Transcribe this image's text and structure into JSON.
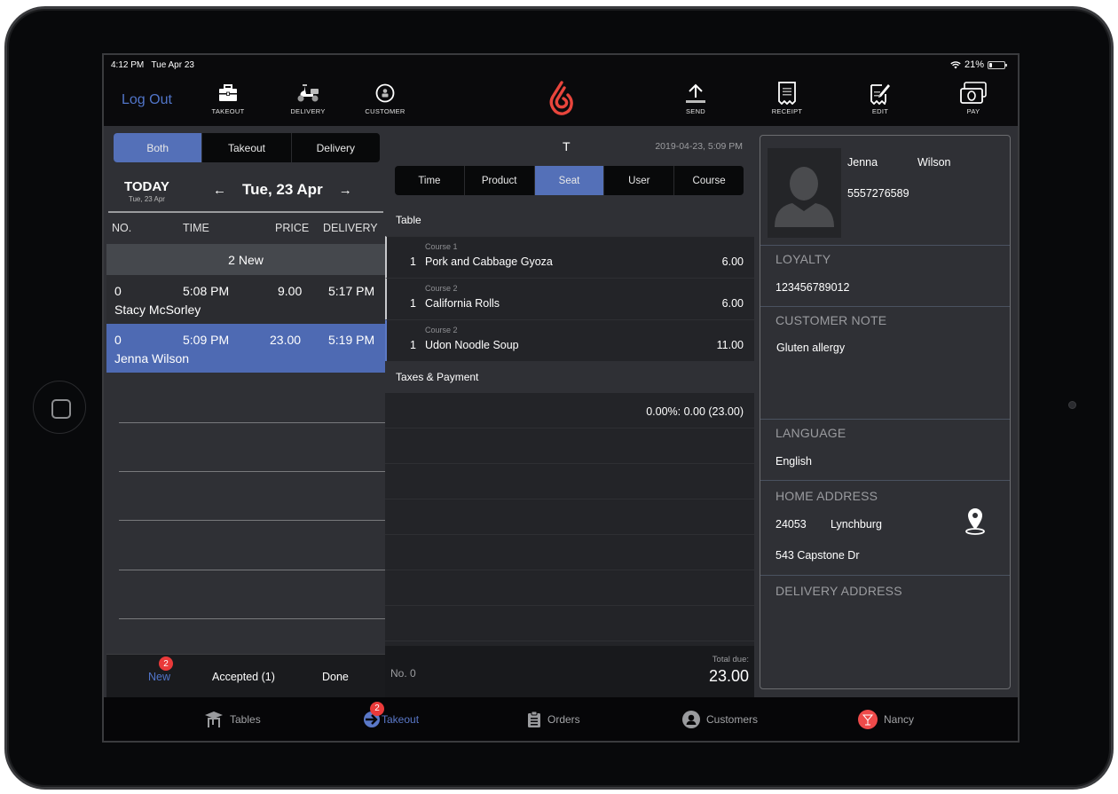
{
  "status_bar": {
    "time": "4:12 PM",
    "date": "Tue Apr 23",
    "battery": "21%",
    "battery_level": 0.21,
    "wifi_icon": "wifi-icon"
  },
  "toolbar": {
    "logout_label": "Log Out",
    "left_tools": [
      {
        "label": "TAKEOUT",
        "icon": "briefcase-icon"
      },
      {
        "label": "DELIVERY",
        "icon": "scooter-icon"
      },
      {
        "label": "CUSTOMER",
        "icon": "customer-circle-icon"
      }
    ],
    "right_tools": [
      {
        "label": "SEND",
        "icon": "upload-icon"
      },
      {
        "label": "RECEIPT",
        "icon": "receipt-icon"
      },
      {
        "label": "EDIT",
        "icon": "edit-receipt-icon"
      },
      {
        "label": "PAY",
        "icon": "cash-icon"
      }
    ],
    "logo_color": "#e8453c"
  },
  "left_panel": {
    "filter_tabs": [
      "Both",
      "Takeout",
      "Delivery"
    ],
    "active_filter": "Both",
    "today_label": "TODAY",
    "today_sub": "Tue, 23 Apr",
    "current_date": "Tue, 23 Apr",
    "prev_arrow": "←",
    "next_arrow": "→",
    "columns": [
      "NO.",
      "TIME",
      "PRICE",
      "DELIVERY"
    ],
    "group_header": "2 New",
    "orders": [
      {
        "no": "0",
        "time": "5:08 PM",
        "price": "9.00",
        "delivery": "5:17 PM",
        "customer": "Stacy McSorley",
        "selected": false
      },
      {
        "no": "0",
        "time": "5:09 PM",
        "price": "23.00",
        "delivery": "5:19 PM",
        "customer": "Jenna Wilson",
        "selected": true
      }
    ],
    "status_tabs": [
      {
        "label": "New",
        "badge": "2",
        "active": true
      },
      {
        "label": "Accepted (1)",
        "active": false
      },
      {
        "label": "Done",
        "active": false
      }
    ]
  },
  "order_detail": {
    "title": "T",
    "datetime": "2019-04-23, 5:09 PM",
    "sort_tabs": [
      "Time",
      "Product",
      "Seat",
      "User",
      "Course"
    ],
    "active_sort": "Seat",
    "table_header": "Table",
    "items": [
      {
        "course": "Course 1",
        "qty": "1",
        "name": "Pork and Cabbage Gyoza",
        "price": "6.00"
      },
      {
        "course": "Course 2",
        "qty": "1",
        "name": "California Rolls",
        "price": "6.00"
      },
      {
        "course": "Course 2",
        "qty": "1",
        "name": "Udon Noodle Soup",
        "price": "11.00"
      }
    ],
    "taxes_header": "Taxes & Payment",
    "tax_line": "0.00%: 0.00 (23.00)",
    "order_no": "No. 0",
    "total_label": "Total due:",
    "total_value": "23.00"
  },
  "customer": {
    "first_name": "Jenna",
    "last_name": "Wilson",
    "phone": "5557276589",
    "loyalty_label": "LOYALTY",
    "loyalty_value": "123456789012",
    "note_label": "CUSTOMER NOTE",
    "note_value": "Gluten allergy",
    "language_label": "LANGUAGE",
    "language_value": "English",
    "home_address_label": "HOME ADDRESS",
    "zip": "24053",
    "city": "Lynchburg",
    "street": "543 Capstone Dr",
    "delivery_address_label": "DELIVERY ADDRESS"
  },
  "bottom_nav": [
    {
      "label": "Tables",
      "icon": "table-icon",
      "active": false
    },
    {
      "label": "Takeout",
      "icon": "takeout-arrow-icon",
      "active": true,
      "badge": "2"
    },
    {
      "label": "Orders",
      "icon": "clipboard-icon",
      "active": false
    },
    {
      "label": "Customers",
      "icon": "person-circle-icon",
      "active": false
    },
    {
      "label": "Nancy",
      "icon": "user-avatar-icon",
      "active": false
    }
  ],
  "colors": {
    "accent": "#5470b8",
    "accent_text": "#5175c9",
    "badge": "#ea3a3a",
    "logo": "#e8453c",
    "background": "#2f3035"
  }
}
